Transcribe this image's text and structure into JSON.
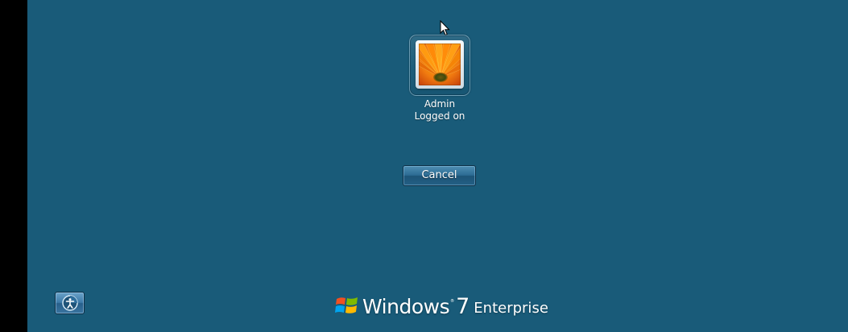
{
  "colors": {
    "background": "#195b79",
    "left_bar": "#000000",
    "text": "#ffffff",
    "button_top": "#4f8fb3",
    "button_bottom": "#245f85"
  },
  "user_tile": {
    "picture": "orange-gerbera-flower",
    "name": "Admin",
    "status": "Logged on"
  },
  "cancel_button": {
    "label": "Cancel"
  },
  "ease_of_access_button": {
    "icon": "ease-of-access-icon"
  },
  "branding": {
    "logo": "windows-flag-logo",
    "product": "Windows",
    "trademark": "®",
    "version": "7",
    "edition": "Enterprise"
  },
  "pointer": {
    "icon": "mouse-cursor-icon"
  }
}
